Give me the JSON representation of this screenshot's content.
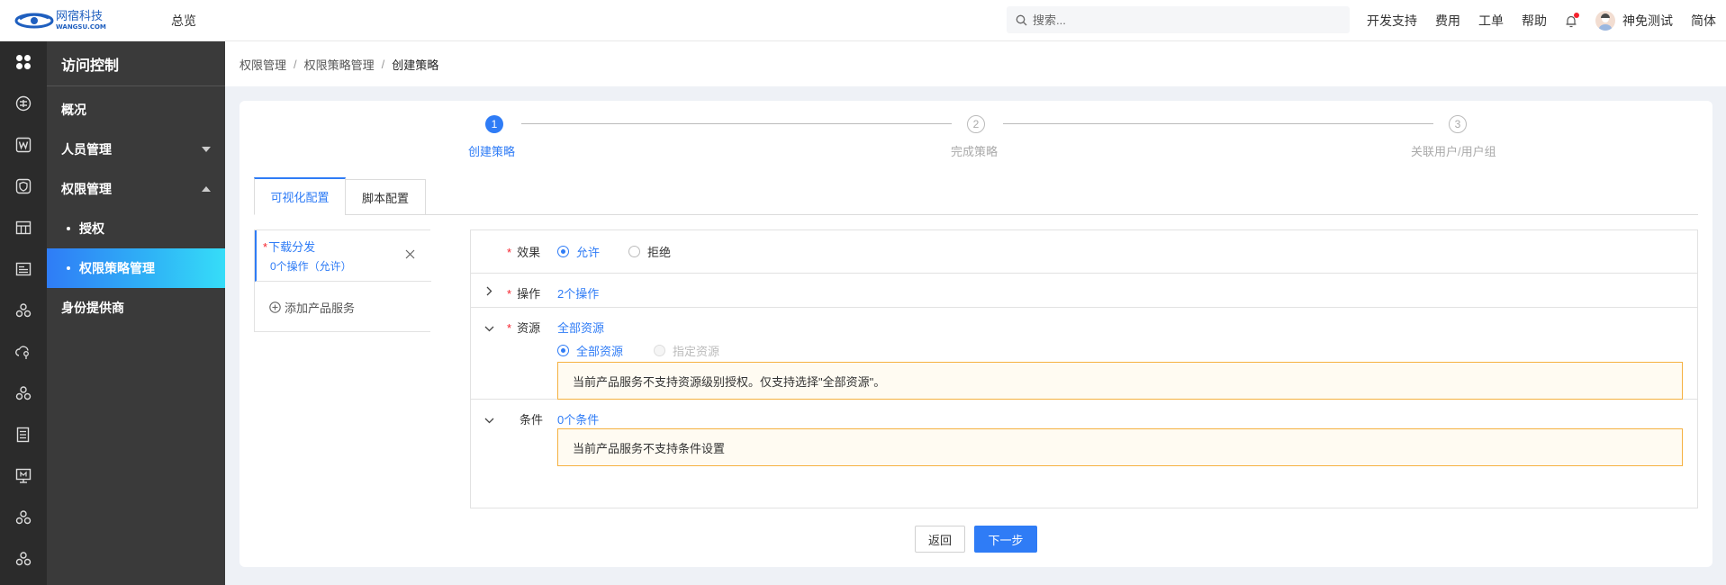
{
  "header": {
    "logo_text": "网宿科技",
    "logo_sub": "WANGSU.COM",
    "overview": "总览",
    "search_placeholder": "搜索...",
    "nav": [
      "开发支持",
      "费用",
      "工单",
      "帮助"
    ],
    "user_name": "神免测试",
    "language": "简体"
  },
  "rail": {
    "icons": [
      "apps-icon",
      "settings-circle-icon",
      "w-box-icon",
      "shield-box-icon",
      "grid-table-icon",
      "document-list-icon",
      "cluster-icon",
      "cloud-key-icon",
      "cluster-icon",
      "doc-lines-icon",
      "monitor-icon",
      "cluster-icon",
      "cluster-icon"
    ]
  },
  "sidemenu": {
    "title": "访问控制",
    "overview": "概况",
    "people": "人员管理",
    "permissions": "权限管理",
    "authorize": "授权",
    "policy_mgmt": "权限策略管理",
    "idp": "身份提供商"
  },
  "breadcrumb": [
    "权限管理",
    "权限策略管理",
    "创建策略"
  ],
  "steps": [
    {
      "num": "1",
      "label": "创建策略"
    },
    {
      "num": "2",
      "label": "完成策略"
    },
    {
      "num": "3",
      "label": "关联用户/用户组"
    }
  ],
  "tabs": [
    "可视化配置",
    "脚本配置"
  ],
  "service": {
    "name": "下载分发",
    "summary": "0个操作（允许）",
    "add": "添加产品服务"
  },
  "config": {
    "effect": {
      "label": "效果",
      "allow": "允许",
      "deny": "拒绝"
    },
    "action": {
      "label": "操作",
      "value": "2个操作"
    },
    "resource": {
      "label": "资源",
      "value": "全部资源",
      "opt_all": "全部资源",
      "opt_specific": "指定资源",
      "warning": "当前产品服务不支持资源级别授权。仅支持选择\"全部资源\"。"
    },
    "condition": {
      "label": "条件",
      "value": "0个条件",
      "warning": "当前产品服务不支持条件设置"
    }
  },
  "buttons": {
    "back": "返回",
    "next": "下一步"
  },
  "colors": {
    "primary": "#2f7cf6",
    "required": "#f5222d",
    "warning_border": "#f5b141",
    "warning_bg": "#fffbf2",
    "sidebar": "#3a3a3a",
    "rail": "#2b2b2b"
  }
}
